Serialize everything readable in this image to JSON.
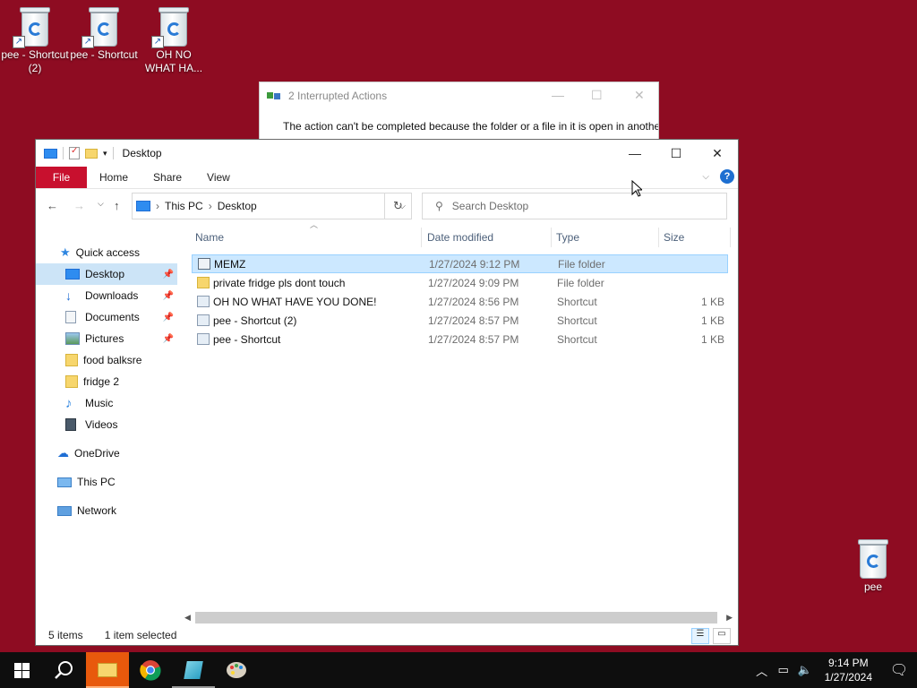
{
  "desktop": {
    "icons": [
      {
        "label": "pee - Shortcut (2)"
      },
      {
        "label": "pee - Shortcut"
      },
      {
        "label": "OH NO WHAT HA..."
      },
      {
        "label": "pee"
      }
    ]
  },
  "dialog": {
    "title": "2 Interrupted Actions",
    "message": "The action can't be completed because the folder or a file in it is open in another program"
  },
  "explorer": {
    "title": "Desktop",
    "ribbon_tabs": [
      "File",
      "Home",
      "Share",
      "View"
    ],
    "breadcrumb": [
      "This PC",
      "Desktop"
    ],
    "search_placeholder": "Search Desktop",
    "nav": {
      "quick_access": "Quick access",
      "items": [
        "Desktop",
        "Downloads",
        "Documents",
        "Pictures",
        "food balksre",
        "fridge 2",
        "Music",
        "Videos"
      ],
      "onedrive": "OneDrive",
      "this_pc": "This PC",
      "network": "Network"
    },
    "columns": [
      "Name",
      "Date modified",
      "Type",
      "Size"
    ],
    "rows": [
      {
        "name": "MEMZ",
        "date": "1/27/2024 9:12 PM",
        "type": "File folder",
        "size": ""
      },
      {
        "name": "private fridge pls dont touch",
        "date": "1/27/2024 9:09 PM",
        "type": "File folder",
        "size": ""
      },
      {
        "name": "OH NO WHAT HAVE YOU DONE!",
        "date": "1/27/2024 8:56 PM",
        "type": "Shortcut",
        "size": "1 KB"
      },
      {
        "name": "pee - Shortcut (2)",
        "date": "1/27/2024 8:57 PM",
        "type": "Shortcut",
        "size": "1 KB"
      },
      {
        "name": "pee - Shortcut",
        "date": "1/27/2024 8:57 PM",
        "type": "Shortcut",
        "size": "1 KB"
      }
    ],
    "status": {
      "count": "5 items",
      "selected": "1 item selected"
    }
  },
  "taskbar": {
    "time": "9:14 PM",
    "date": "1/27/2024"
  },
  "colors": {
    "desktop": "#8e0c22",
    "file_tab": "#c8102e",
    "selection": "#cce8ff",
    "taskbar": "#0e0e0e"
  }
}
